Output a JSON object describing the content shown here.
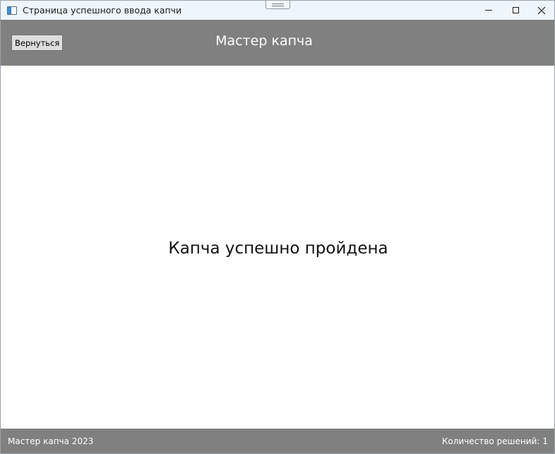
{
  "window": {
    "title": "Страница успешного ввода капчи",
    "minimize_icon": "minimize-icon",
    "maximize_icon": "maximize-icon",
    "close_icon": "close-icon"
  },
  "header": {
    "back_button_label": "Вернуться",
    "title": "Мастер капча"
  },
  "main": {
    "message": "Капча успешно пройдена"
  },
  "footer": {
    "copyright": "Мастер капча 2023",
    "solutions_label": "Количество решений:",
    "solutions_count": "1"
  },
  "colors": {
    "titlebar_bg": "#eef5fb",
    "header_bg": "#808080",
    "footer_bg": "#808080",
    "button_bg": "#dddddd",
    "content_bg": "#ffffff"
  }
}
